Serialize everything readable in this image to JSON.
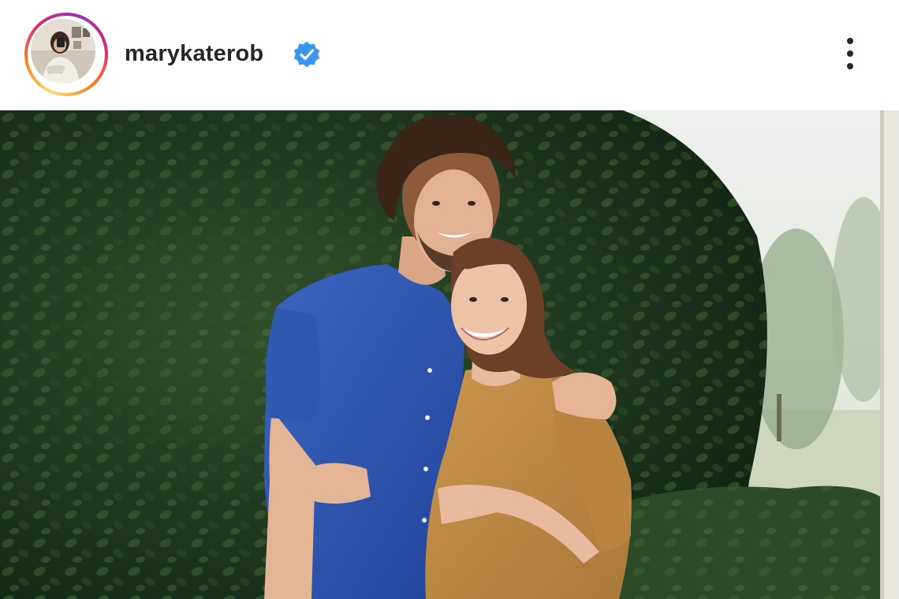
{
  "post": {
    "username": "marykaterob",
    "verified": true
  },
  "icons": {
    "verified": "verified-badge-icon",
    "more": "more-options-vertical-icon"
  },
  "colors": {
    "username_text": "#262626",
    "verified_badge": "#3797f0",
    "story_ring": [
      "#feda75",
      "#fa7e1e",
      "#d62976",
      "#962fbf"
    ]
  }
}
